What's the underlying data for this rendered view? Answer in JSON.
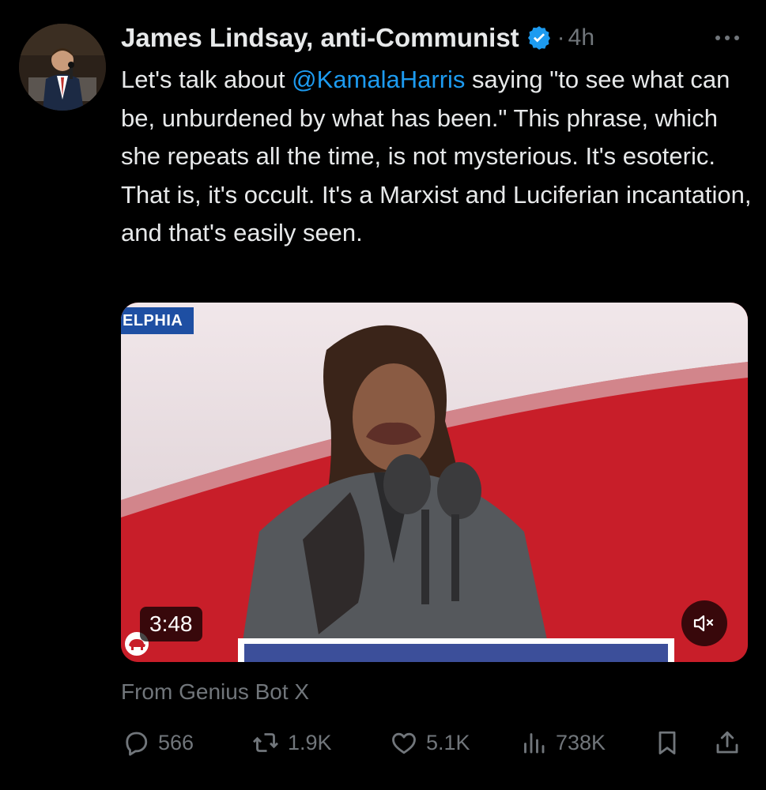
{
  "author": {
    "display_name": "James Lindsay, anti-Communist",
    "verified_icon": "verified-badge-icon",
    "separator": "·",
    "timestamp": "4h"
  },
  "tweet": {
    "text_before_mention": "Let's talk about ",
    "mention": "@KamalaHarris",
    "text_after_mention": " saying \"to see what can be, unburdened by what has been.\" This phrase, which she repeats all the time, is not mysterious. It's esoteric. That is, it's occult. It's a Marxist and Luciferian incantation, and that's easily seen."
  },
  "media": {
    "location_tag": "ELPHIA",
    "duration": "3:48",
    "mute_icon": "speaker-muted-icon"
  },
  "source_label": "From Genius Bot X",
  "actions": {
    "replies": "566",
    "reposts": "1.9K",
    "likes": "5.1K",
    "views": "738K"
  },
  "colors": {
    "background": "#000000",
    "text": "#e7e9ea",
    "secondary": "#71767b",
    "accent": "#1d9bf0"
  }
}
